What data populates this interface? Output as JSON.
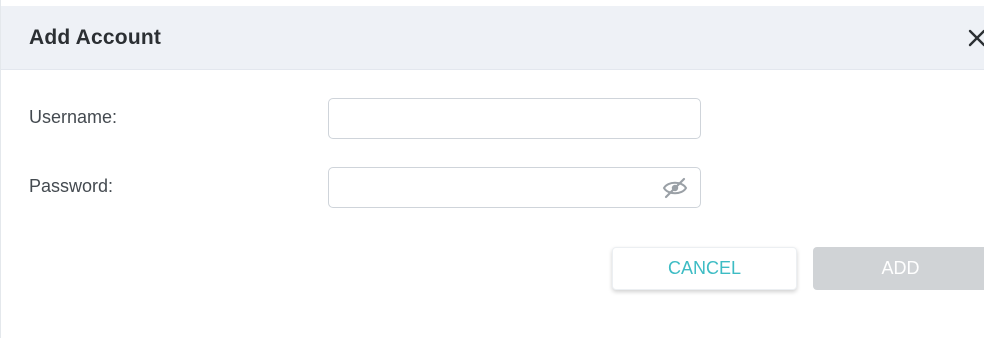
{
  "dialog": {
    "title": "Add Account",
    "close_icon": "close-icon"
  },
  "form": {
    "username": {
      "label": "Username:",
      "value": "",
      "placeholder": ""
    },
    "password": {
      "label": "Password:",
      "value": "",
      "placeholder": "",
      "toggle_icon": "eye-hidden-icon"
    }
  },
  "actions": {
    "cancel_label": "CANCEL",
    "add_label": "ADD",
    "add_disabled": true
  },
  "colors": {
    "header_bg": "#eef1f6",
    "accent": "#3dbcc4",
    "disabled_button": "#d0d3d6"
  }
}
